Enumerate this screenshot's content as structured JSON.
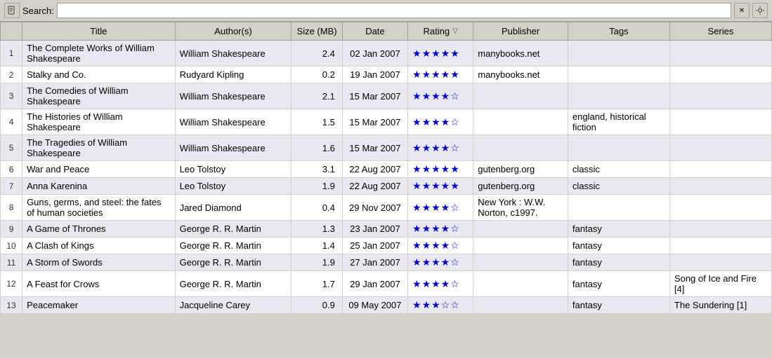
{
  "search": {
    "label": "Search:",
    "placeholder": "",
    "value": ""
  },
  "table": {
    "columns": [
      {
        "key": "num",
        "label": ""
      },
      {
        "key": "title",
        "label": "Title"
      },
      {
        "key": "authors",
        "label": "Author(s)"
      },
      {
        "key": "size",
        "label": "Size (MB)"
      },
      {
        "key": "date",
        "label": "Date"
      },
      {
        "key": "rating",
        "label": "Rating"
      },
      {
        "key": "publisher",
        "label": "Publisher"
      },
      {
        "key": "tags",
        "label": "Tags"
      },
      {
        "key": "series",
        "label": "Series"
      }
    ],
    "rows": [
      {
        "num": 1,
        "title": "The Complete Works of William Shakespeare",
        "authors": "William Shakespeare",
        "size": "2.4",
        "date": "02 Jan 2007",
        "stars": 5,
        "publisher": "manybooks.net",
        "tags": "",
        "series": ""
      },
      {
        "num": 2,
        "title": "Stalky and Co.",
        "authors": "Rudyard Kipling",
        "size": "0.2",
        "date": "19 Jan 2007",
        "stars": 5,
        "publisher": "manybooks.net",
        "tags": "",
        "series": ""
      },
      {
        "num": 3,
        "title": "The Comedies of William Shakespeare",
        "authors": "William Shakespeare",
        "size": "2.1",
        "date": "15 Mar 2007",
        "stars": 4,
        "publisher": "",
        "tags": "",
        "series": ""
      },
      {
        "num": 4,
        "title": "The Histories of William Shakespeare",
        "authors": "William Shakespeare",
        "size": "1.5",
        "date": "15 Mar 2007",
        "stars": 4,
        "publisher": "",
        "tags": "england, historical fiction",
        "series": ""
      },
      {
        "num": 5,
        "title": "The Tragedies of William Shakespeare",
        "authors": "William Shakespeare",
        "size": "1.6",
        "date": "15 Mar 2007",
        "stars": 4,
        "publisher": "",
        "tags": "",
        "series": ""
      },
      {
        "num": 6,
        "title": "War and Peace",
        "authors": "Leo Tolstoy",
        "size": "3.1",
        "date": "22 Aug 2007",
        "stars": 5,
        "publisher": "gutenberg.org",
        "tags": "classic",
        "series": ""
      },
      {
        "num": 7,
        "title": "Anna Karenina",
        "authors": "Leo Tolstoy",
        "size": "1.9",
        "date": "22 Aug 2007",
        "stars": 5,
        "publisher": "gutenberg.org",
        "tags": "classic",
        "series": ""
      },
      {
        "num": 8,
        "title": "Guns, germs, and steel: the fates of human societies",
        "authors": "Jared Diamond",
        "size": "0.4",
        "date": "29 Nov 2007",
        "stars": 4,
        "publisher": "New York : W.W. Norton, c1997.",
        "tags": "",
        "series": ""
      },
      {
        "num": 9,
        "title": "A Game of Thrones",
        "authors": "George R. R. Martin",
        "size": "1.3",
        "date": "23 Jan 2007",
        "stars": 4,
        "publisher": "",
        "tags": "fantasy",
        "series": ""
      },
      {
        "num": 10,
        "title": "A Clash of Kings",
        "authors": "George R. R. Martin",
        "size": "1.4",
        "date": "25 Jan 2007",
        "stars": 4,
        "publisher": "",
        "tags": "fantasy",
        "series": ""
      },
      {
        "num": 11,
        "title": "A Storm of Swords",
        "authors": "George R. R. Martin",
        "size": "1.9",
        "date": "27 Jan 2007",
        "stars": 4,
        "publisher": "",
        "tags": "fantasy",
        "series": ""
      },
      {
        "num": 12,
        "title": "A Feast for Crows",
        "authors": "George R. R. Martin",
        "size": "1.7",
        "date": "29 Jan 2007",
        "stars": 4,
        "publisher": "",
        "tags": "fantasy",
        "series": "Song of Ice and Fire [4]"
      },
      {
        "num": 13,
        "title": "Peacemaker",
        "authors": "Jacqueline Carey",
        "size": "0.9",
        "date": "09 May 2007",
        "stars": 3,
        "publisher": "",
        "tags": "fantasy",
        "series": "The Sundering [1]"
      }
    ]
  },
  "icons": {
    "search": "🔍",
    "clear": "✕",
    "settings": "🔧",
    "sort_desc": "▽"
  }
}
